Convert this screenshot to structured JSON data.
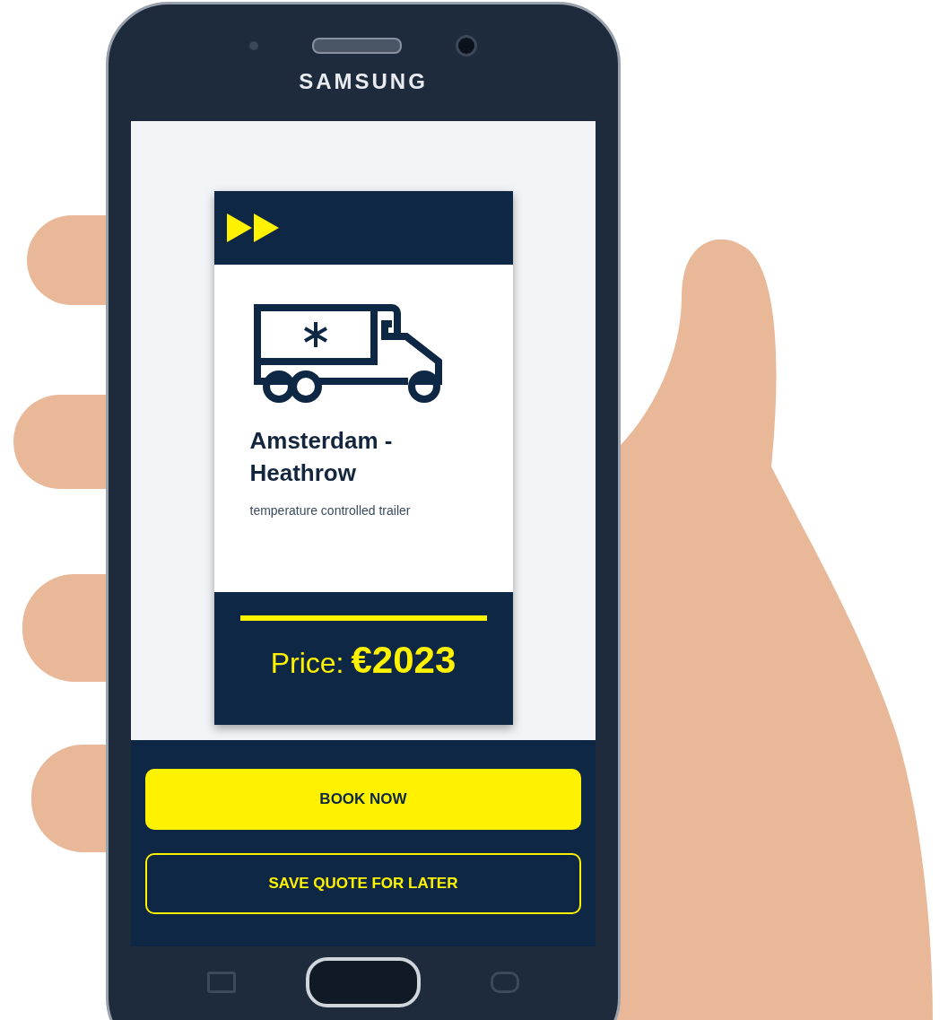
{
  "phone": {
    "brand": "SAMSUNG"
  },
  "card": {
    "title": "Amsterdam - Heathrow",
    "subtitle": "temperature controlled trailer",
    "price_label": "Price:",
    "price": "€2023"
  },
  "buttons": [
    {
      "label": "BOOK NOW",
      "kind": "primary"
    },
    {
      "label": "SAVE QUOTE FOR LATER",
      "kind": "outline"
    }
  ]
}
